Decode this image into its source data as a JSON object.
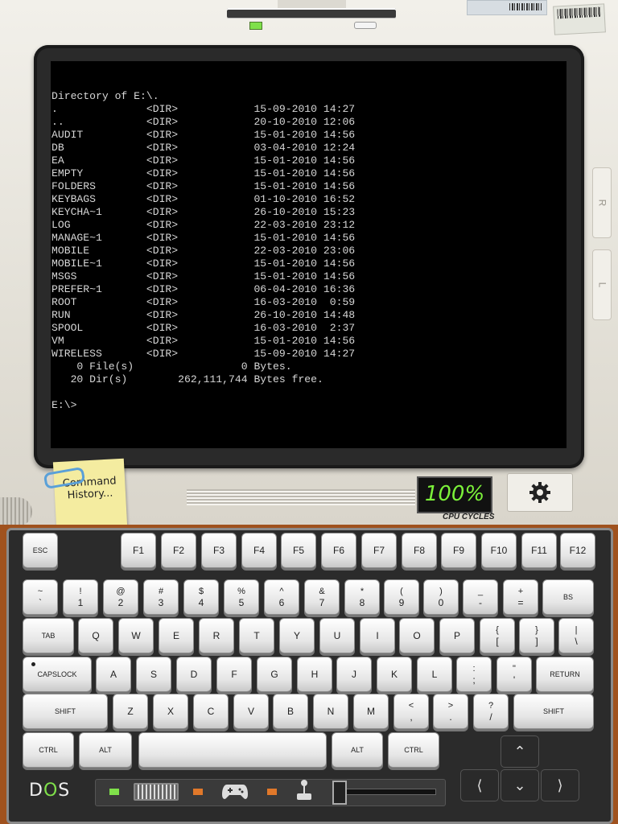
{
  "terminal": {
    "lines": [
      "Directory of E:\\.",
      ".              <DIR>            15-09-2010 14:27",
      "..             <DIR>            20-10-2010 12:06",
      "AUDIT          <DIR>            15-01-2010 14:56",
      "DB             <DIR>            03-04-2010 12:24",
      "EA             <DIR>            15-01-2010 14:56",
      "EMPTY          <DIR>            15-01-2010 14:56",
      "FOLDERS        <DIR>            15-01-2010 14:56",
      "KEYBAGS        <DIR>            01-10-2010 16:52",
      "KEYCHA~1       <DIR>            26-10-2010 15:23",
      "LOG            <DIR>            22-03-2010 23:12",
      "MANAGE~1       <DIR>            15-01-2010 14:56",
      "MOBILE         <DIR>            22-03-2010 23:06",
      "MOBILE~1       <DIR>            15-01-2010 14:56",
      "MSGS           <DIR>            15-01-2010 14:56",
      "PREFER~1       <DIR>            06-04-2010 16:36",
      "ROOT           <DIR>            16-03-2010  0:59",
      "RUN            <DIR>            26-10-2010 14:48",
      "SPOOL          <DIR>            16-03-2010  2:37",
      "VM             <DIR>            15-01-2010 14:56",
      "WIRELESS       <DIR>            15-09-2010 14:27",
      "    0 File(s)                 0 Bytes.",
      "   20 Dir(s)        262,111,744 Bytes free.",
      "",
      "E:\\>"
    ]
  },
  "side_buttons": {
    "right": "R",
    "left": "L"
  },
  "note": {
    "line1": "Command",
    "line2": "History..."
  },
  "cpu": {
    "value": "100%",
    "label": "CPU CYCLES"
  },
  "footer": {
    "logo_d": "D",
    "logo_o": "O",
    "logo_s": "S"
  },
  "keyboard": {
    "esc": "ESC",
    "fkeys": [
      "F1",
      "F2",
      "F3",
      "F4",
      "F5",
      "F6",
      "F7",
      "F8",
      "F9",
      "F10",
      "F11",
      "F12"
    ],
    "number_row": [
      [
        "~",
        "`"
      ],
      [
        "!",
        "1"
      ],
      [
        "@",
        "2"
      ],
      [
        "#",
        "3"
      ],
      [
        "$",
        "4"
      ],
      [
        "%",
        "5"
      ],
      [
        "^",
        "6"
      ],
      [
        "&",
        "7"
      ],
      [
        "*",
        "8"
      ],
      [
        "(",
        "9"
      ],
      [
        ")",
        "0"
      ],
      [
        "_",
        "-"
      ],
      [
        "+",
        "="
      ]
    ],
    "bs": "BS",
    "tab": "TAB",
    "qrow": [
      "Q",
      "W",
      "E",
      "R",
      "T",
      "Y",
      "U",
      "I",
      "O",
      "P"
    ],
    "qrow_extra": [
      [
        "{",
        "["
      ],
      [
        "}",
        "]"
      ],
      [
        "|",
        "\\"
      ]
    ],
    "capslock": "CAPSLOCK",
    "arow": [
      "A",
      "S",
      "D",
      "F",
      "G",
      "H",
      "J",
      "K",
      "L"
    ],
    "arow_extra": [
      [
        ":",
        ";"
      ],
      [
        "\"",
        "'"
      ]
    ],
    "return": "RETURN",
    "shift": "SHIFT",
    "zrow": [
      "Z",
      "X",
      "C",
      "V",
      "B",
      "N",
      "M"
    ],
    "zrow_extra": [
      [
        "<",
        ","
      ],
      [
        ">",
        "."
      ],
      [
        "?",
        "/"
      ]
    ],
    "ctrl": "CTRL",
    "alt": "ALT"
  },
  "colors": {
    "screen_bg": "#000000",
    "led_green": "#7fe04a",
    "led_orange": "#e0782a",
    "wood": "#a0521e"
  }
}
